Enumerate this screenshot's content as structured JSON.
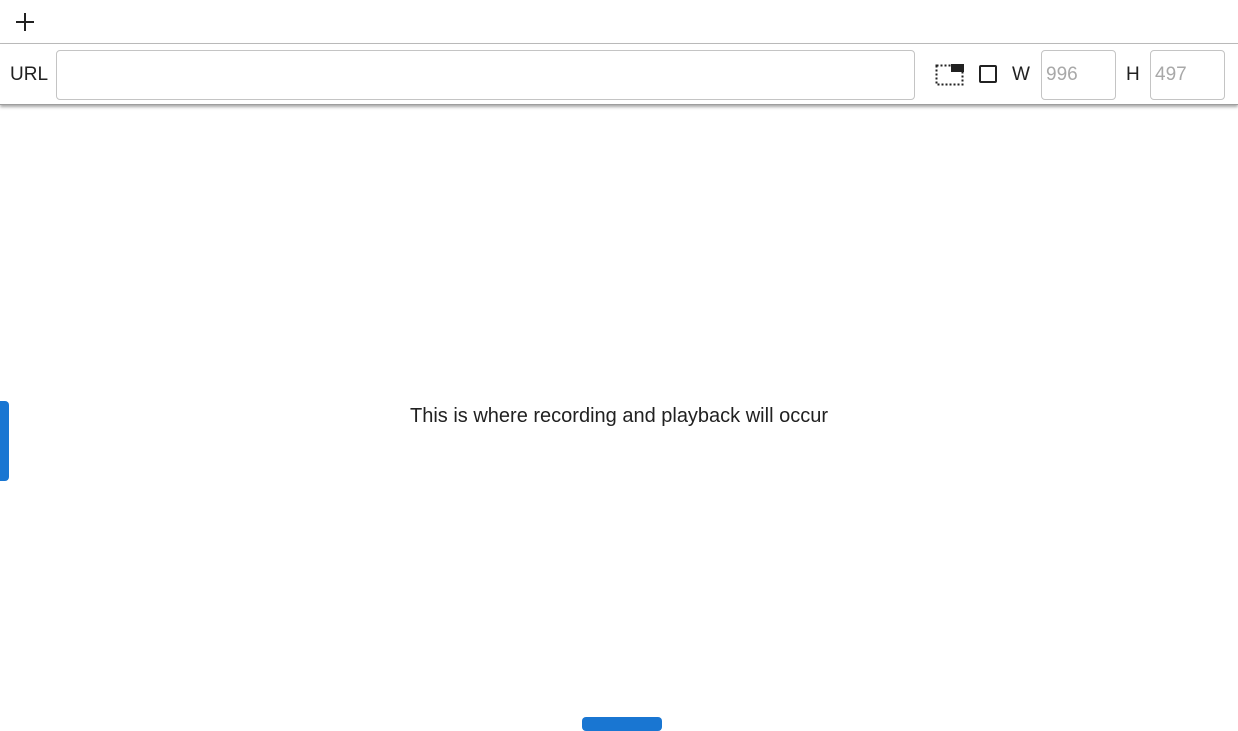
{
  "tabbar": {
    "add_tab_icon": "plus-icon"
  },
  "toolbar": {
    "url_label": "URL",
    "url_value": "",
    "url_placeholder": "",
    "viewport_icon": "viewport-select-icon",
    "width_label": "W",
    "width_placeholder": "996",
    "height_label": "H",
    "height_placeholder": "497"
  },
  "stage": {
    "message": "This is where recording and playback will occur"
  },
  "colors": {
    "accent": "#1976d2",
    "text": "#212121",
    "border": "#c4c4c4",
    "placeholder": "#a8a8a8"
  }
}
